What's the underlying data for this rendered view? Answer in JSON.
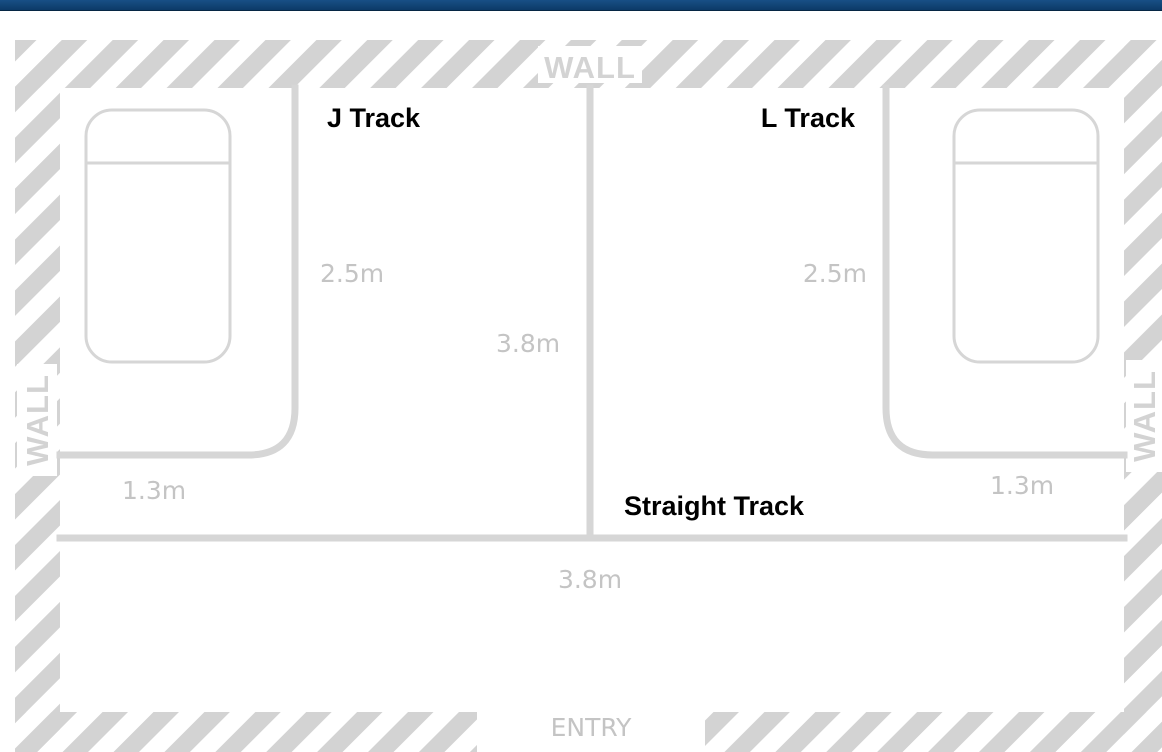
{
  "colors": {
    "header_bar": "#124477",
    "wall_hatch": "#d3d3d3",
    "track_line": "#d6d6d6",
    "dimension_text": "#c4c4c4",
    "label_text": "#000000"
  },
  "walls": {
    "top_label": "WALL",
    "left_label": "WALL",
    "right_label": "WALL",
    "entry_label": "ENTRY"
  },
  "tracks": {
    "j_track": "J Track",
    "l_track": "L Track",
    "straight_track": "Straight Track"
  },
  "dimensions": {
    "j_vertical": "2.5m",
    "center_vertical": "3.8m",
    "l_vertical": "2.5m",
    "left_horizontal": "1.3m",
    "right_horizontal": "1.3m",
    "bottom_horizontal": "3.8m"
  },
  "furniture": [
    {
      "name": "bed-left",
      "icon": "bed-icon"
    },
    {
      "name": "bed-right",
      "icon": "bed-icon"
    }
  ]
}
